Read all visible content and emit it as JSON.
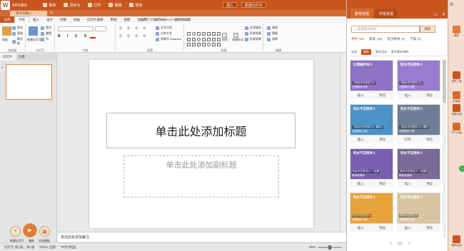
{
  "app": {
    "name": "WPS演示",
    "doc_tab": "演示文稿1 *",
    "doc_title": "演示文稿1 - Microsoft PowerPoint"
  },
  "quick_access": [
    "保存",
    "另存为",
    "打开",
    "撤销",
    "恢复"
  ],
  "titlebar_buttons": [
    "插入",
    "新建幻灯片"
  ],
  "ribbon_tabs": [
    "文件",
    "开始",
    "插入",
    "设计",
    "切换",
    "动画",
    "幻灯片放映",
    "审阅",
    "视图",
    "加载项",
    "福昕PDF",
    "福昕阅读器"
  ],
  "ribbon_groups": {
    "clipboard": {
      "label": "剪贴板",
      "items": [
        "粘贴",
        "剪切",
        "复制",
        "格式刷"
      ]
    },
    "slides": {
      "label": "幻灯片",
      "items": [
        "新建幻灯片",
        "版式",
        "重置",
        "节"
      ]
    },
    "font": {
      "label": "字体"
    },
    "paragraph": {
      "label": "段落",
      "items": [
        "文字方向",
        "对齐文本",
        "转换为 SmartArt"
      ]
    },
    "drawing": {
      "label": "绘图",
      "items": [
        "排列",
        "快速样式",
        "形状填充",
        "形状轮廓",
        "形状效果"
      ]
    },
    "editing": {
      "label": "编辑",
      "items": [
        "查找",
        "替换",
        "选择"
      ]
    }
  },
  "left_panel": {
    "tabs": [
      "幻灯片",
      "大纲"
    ],
    "thumb_number": "1",
    "buttons": [
      "新建幻灯片",
      "播放",
      "文档模板"
    ]
  },
  "slide": {
    "title_placeholder": "单击此处添加标题",
    "subtitle_placeholder": "单击此处添加副标题"
  },
  "notes_placeholder": "单击此处添加备注",
  "statusbar": {
    "slide_info": "幻灯片 第1张，共1张",
    "theme": "\"Office 主题\"",
    "language": "中文(中国)",
    "zoom": "58%"
  },
  "resource_panel": {
    "tabs": [
      "教育资源",
      "共享资源"
    ],
    "search_placeholder": "搜索相关资料",
    "search_button": "搜索",
    "categories": [
      "课件 (25)",
      "教案 (12)",
      "电子教材 (1)",
      "学案 (1)"
    ],
    "filters": [
      "全部",
      "课件",
      "教学设计",
      "教学素材/课件"
    ],
    "cards": [
      {
        "heading": "让我做护林人",
        "line1": "《吃水不忘挖井人》",
        "line2": "全国课件大赛",
        "teacher": "杨小静",
        "actions": [
          "插入",
          "预览"
        ],
        "bg": "#8e72c6"
      },
      {
        "heading": "吃水不忘挖井人",
        "line1": "《吃水不忘挖井人》",
        "line2": "全国课件大赛",
        "teacher": "马晓明",
        "actions": [
          "插入",
          "预览"
        ],
        "bg": "#9b7bd1"
      },
      {
        "heading": "吃水不忘挖井人",
        "line1": "《吃水不忘挖井人》课件1",
        "line2": "全国课件大赛",
        "teacher": "",
        "actions": [
          "插入",
          "预览"
        ],
        "bg": "#4c91c8"
      },
      {
        "heading": "吃水不忘挖井人",
        "line1": "《吃水不忘挖井人》课件",
        "line2": "全国课件大赛",
        "teacher": "",
        "actions": [
          "打开",
          "预览"
        ],
        "bg": "#6c7f96"
      },
      {
        "heading": "吃水不忘挖井人",
        "line1": "吃水不忘挖井人·一线课",
        "line2": "教育资源库",
        "teacher": "",
        "actions": [
          "插入",
          "预览"
        ],
        "bg": "#7a5fb0"
      },
      {
        "heading": "吃水不忘挖井人",
        "line1": "吃水不忘挖井人·一线课",
        "line2": "教育资源库",
        "teacher": "",
        "actions": [
          "插入",
          "预览"
        ],
        "bg": "#7a6a9a"
      },
      {
        "heading": "吃水不忘挖井人",
        "line1": "吃水不忘挖井人",
        "line2": "全国课件大赛",
        "teacher": "",
        "actions": [
          "插入",
          "预览"
        ],
        "bg": "#e8a23a"
      },
      {
        "heading": "吃水不忘挖井人",
        "line1": "吃水不忘挖井人",
        "line2": "全国课件大赛",
        "teacher": "",
        "actions": [
          "插入",
          "预览"
        ],
        "bg": "#d9c4a0"
      }
    ],
    "pager": {
      "prev": "<",
      "page": "1/2",
      "next": ">"
    }
  },
  "sidebar": {
    "top_label": "教",
    "items": [
      {
        "label": "课件",
        "color": "#e07a35"
      },
      {
        "label": "学科工具",
        "color": "#c9561e"
      },
      {
        "label": "多媒体",
        "color": "#d46a2e"
      },
      {
        "label": "习题/试卷",
        "color": "#c9561e"
      },
      {
        "label": "PPT大纲",
        "color": "#d46a2e"
      },
      {
        "label": "教师空间",
        "color": "#c9561e"
      }
    ]
  },
  "colors": {
    "accent": "#c9561e",
    "panel_header": "#c9561e"
  }
}
